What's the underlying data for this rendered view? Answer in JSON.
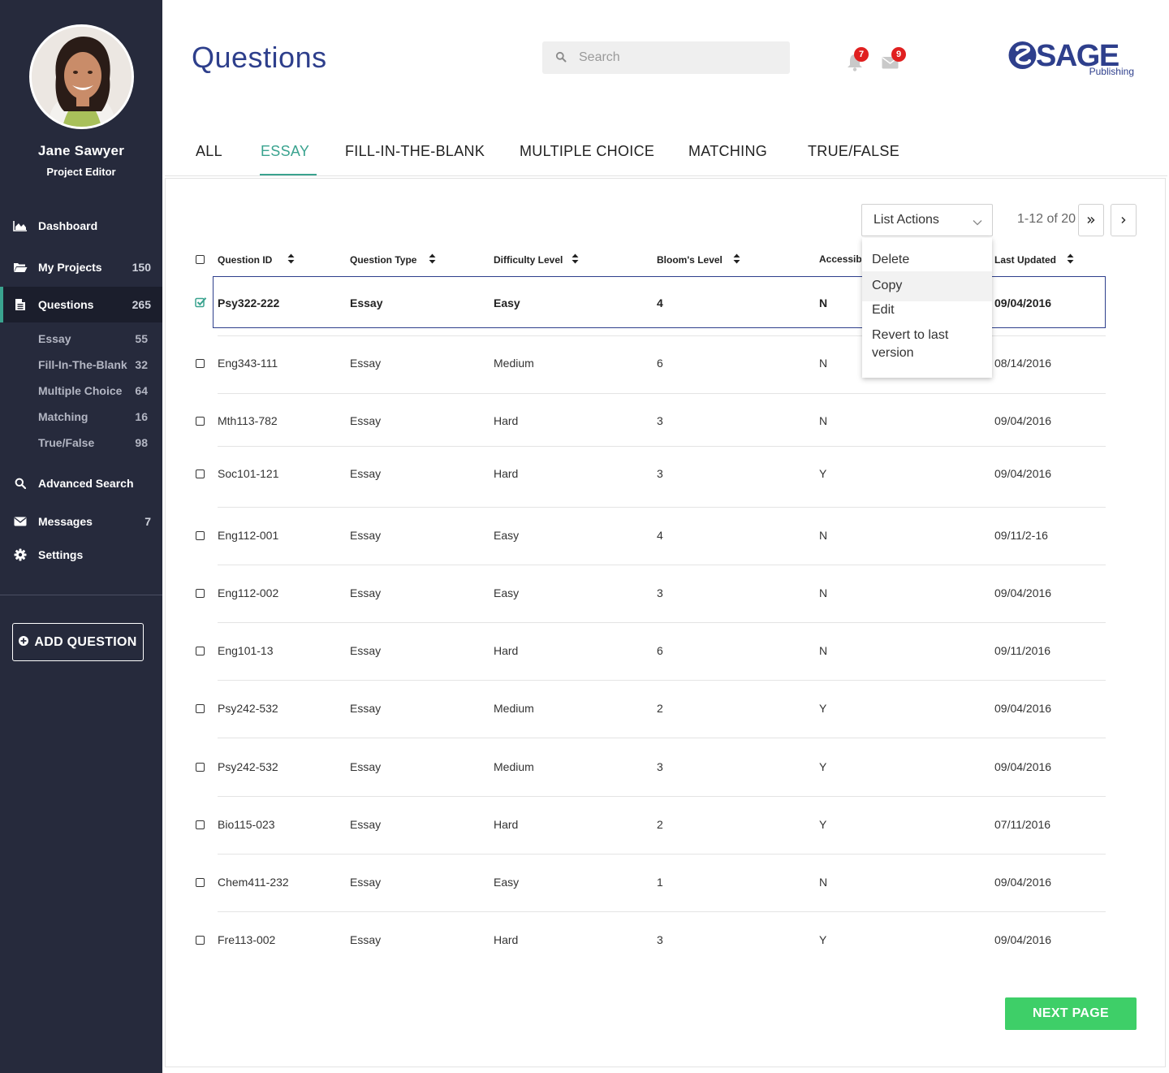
{
  "user": {
    "name": "Jane Sawyer",
    "role": "Project Editor"
  },
  "nav": {
    "items": [
      {
        "label": "Dashboard",
        "count": "",
        "icon": "chart-area-icon"
      },
      {
        "label": "My Projects",
        "count": "150",
        "icon": "folder-open-icon"
      },
      {
        "label": "Questions",
        "count": "265",
        "icon": "document-icon"
      },
      {
        "label": "Advanced Search",
        "count": "",
        "icon": "search-icon"
      },
      {
        "label": "Messages",
        "count": "7",
        "icon": "envelope-icon"
      },
      {
        "label": "Settings",
        "count": "",
        "icon": "gear-icon"
      }
    ],
    "subitems": [
      {
        "label": "Essay",
        "count": "55"
      },
      {
        "label": "Fill-In-The-Blank",
        "count": "32"
      },
      {
        "label": "Multiple Choice",
        "count": "64"
      },
      {
        "label": "Matching",
        "count": "16"
      },
      {
        "label": "True/False",
        "count": "98"
      }
    ],
    "add_question": "ADD QUESTION"
  },
  "header": {
    "title": "Questions",
    "search_placeholder": "Search",
    "notifications_count": "7",
    "messages_count": "9",
    "logo": {
      "main": "SAGE",
      "sub": "Publishing"
    }
  },
  "tabs": [
    "ALL",
    "ESSAY",
    "FILL-IN-THE-BLANK",
    "MULTIPLE CHOICE",
    "MATCHING",
    "TRUE/FALSE"
  ],
  "active_tab": "ESSAY",
  "list_actions": {
    "label": "List Actions",
    "options": [
      "Delete",
      "Copy",
      "Edit",
      "Revert to last version"
    ],
    "hovered": "Copy"
  },
  "pager": {
    "text": "1-12 of 20"
  },
  "table": {
    "columns": [
      "Question ID",
      "Question Type",
      "Difficulty Level",
      "Bloom's Level",
      "Accessible",
      "Last Updated"
    ],
    "rows": [
      [
        "Psy322-222",
        "Essay",
        "Easy",
        "4",
        "N",
        "09/04/2016"
      ],
      [
        "Eng343-111",
        "Essay",
        "Medium",
        "6",
        "N",
        "08/14/2016"
      ],
      [
        "Mth113-782",
        "Essay",
        "Hard",
        "3",
        "N",
        "09/04/2016"
      ],
      [
        "Soc101-121",
        "Essay",
        "Hard",
        "3",
        "Y",
        "09/04/2016"
      ],
      [
        "Eng112-001",
        "Essay",
        "Easy",
        "4",
        "N",
        "09/11/2-16"
      ],
      [
        "Eng112-002",
        "Essay",
        "Easy",
        "3",
        "N",
        "09/04/2016"
      ],
      [
        "Eng101-13",
        "Essay",
        "Hard",
        "6",
        "N",
        "09/11/2016"
      ],
      [
        "Psy242-532",
        "Essay",
        "Medium",
        "2",
        "Y",
        "09/04/2016"
      ],
      [
        "Psy242-532",
        "Essay",
        "Medium",
        "3",
        "Y",
        "09/04/2016"
      ],
      [
        "Bio115-023",
        "Essay",
        "Hard",
        "2",
        "Y",
        "07/11/2016"
      ],
      [
        "Chem411-232",
        "Essay",
        "Easy",
        "1",
        "N",
        "09/04/2016"
      ],
      [
        "Fre113-002",
        "Essay",
        "Hard",
        "3",
        "Y",
        "09/04/2016"
      ]
    ],
    "selected_row": 0
  },
  "next_page": "NEXT PAGE",
  "colors": {
    "sidebar": "#262a3c",
    "accent": "#3aa38f",
    "title": "#2e3f8c",
    "next_button": "#3ecf68",
    "badge": "#e02020"
  }
}
